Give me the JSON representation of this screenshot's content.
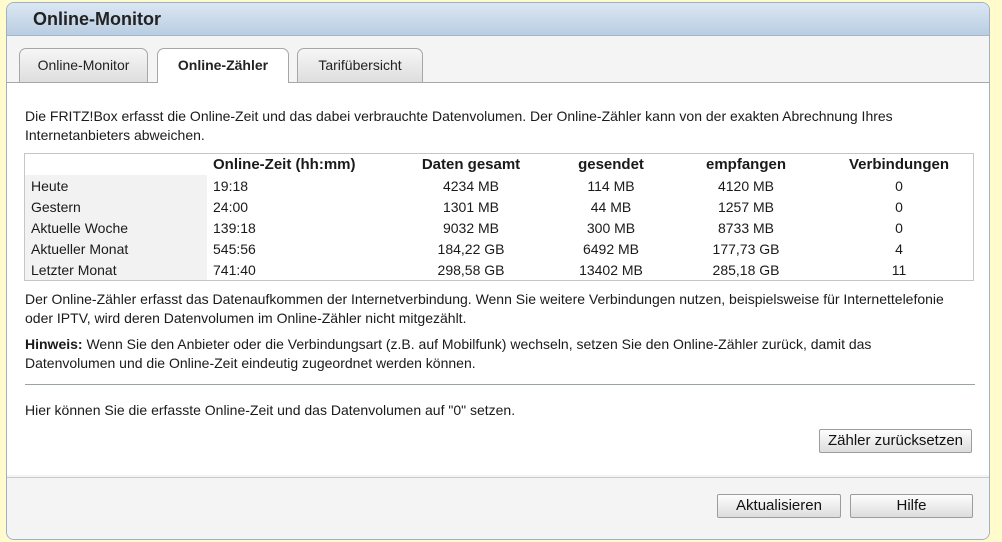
{
  "window": {
    "title": "Online-Monitor"
  },
  "tabs": [
    {
      "label": "Online-Monitor"
    },
    {
      "label": "Online-Zähler"
    },
    {
      "label": "Tarifübersicht"
    }
  ],
  "intro": "Die FRITZ!Box erfasst die Online-Zeit und das dabei verbrauchte Datenvolumen. Der Online-Zähler kann von der exakten Abrechnung Ihres Internetanbieters abweichen.",
  "table": {
    "headers": [
      "",
      "Online-Zeit (hh:mm)",
      "Daten gesamt",
      "gesendet",
      "empfangen",
      "Verbindungen"
    ],
    "rows": [
      {
        "label": "Heute",
        "time": "19:18",
        "total": "4234 MB",
        "sent": "114 MB",
        "received": "4120 MB",
        "connections": "0"
      },
      {
        "label": "Gestern",
        "time": "24:00",
        "total": "1301 MB",
        "sent": "44 MB",
        "received": "1257 MB",
        "connections": "0"
      },
      {
        "label": "Aktuelle Woche",
        "time": "139:18",
        "total": "9032 MB",
        "sent": "300 MB",
        "received": "8733 MB",
        "connections": "0"
      },
      {
        "label": "Aktueller Monat",
        "time": "545:56",
        "total": "184,22 GB",
        "sent": "6492 MB",
        "received": "177,73 GB",
        "connections": "4"
      },
      {
        "label": "Letzter Monat",
        "time": "741:40",
        "total": "298,58 GB",
        "sent": "13402 MB",
        "received": "285,18 GB",
        "connections": "11"
      }
    ]
  },
  "note": "Der Online-Zähler erfasst das Datenaufkommen der Internetverbindung. Wenn Sie weitere Verbindungen nutzen, beispielsweise für Internettelefonie oder IPTV, wird deren Datenvolumen im Online-Zähler nicht mitgezählt.",
  "hint": {
    "label": "Hinweis:",
    "text": " Wenn Sie den Anbieter oder die Verbindungsart (z.B. auf Mobilfunk) wechseln, setzen Sie den Online-Zähler zurück, damit das Datenvolumen und die Online-Zeit eindeutig zugeordnet werden können."
  },
  "reset_text": "Hier können Sie die erfasste Online-Zeit und das Datenvolumen auf \"0\" setzen.",
  "buttons": {
    "reset": "Zähler zurücksetzen",
    "refresh": "Aktualisieren",
    "help": "Hilfe"
  }
}
